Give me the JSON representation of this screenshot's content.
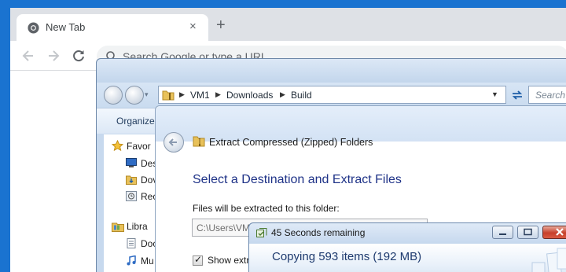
{
  "chrome": {
    "tab_title": "New Tab",
    "tab_close": "×",
    "new_tab": "+",
    "omnibox_placeholder": "Search Google or type a URL"
  },
  "explorer": {
    "breadcrumbs": [
      "VM1",
      "Downloads",
      "Build"
    ],
    "search_placeholder": "Search B",
    "toolbar": {
      "organize": "Organize"
    },
    "nav_pane": {
      "favorites": "Favor",
      "desktop": "Des",
      "downloads": "Dov",
      "recent": "Rec",
      "libraries": "Libra",
      "documents": "Doc",
      "music": "Mu"
    }
  },
  "extract_wizard": {
    "title": "Extract Compressed (Zipped) Folders",
    "heading": "Select a Destination and Extract Files",
    "destination_label": "Files will be extracted to this folder:",
    "destination_path": "C:\\Users\\VM",
    "show_files_label": "Show extra",
    "show_files_checked": true
  },
  "copy_progress": {
    "title": "45 Seconds remaining",
    "heading": "Copying 593 items (192 MB)"
  },
  "colors": {
    "desktop": "#1a73d0",
    "chrome_tabstrip": "#dee1e6",
    "explorer_chrome": "#c7d9ee",
    "wizard_heading": "#1e3287",
    "close_button": "#c7402b"
  }
}
